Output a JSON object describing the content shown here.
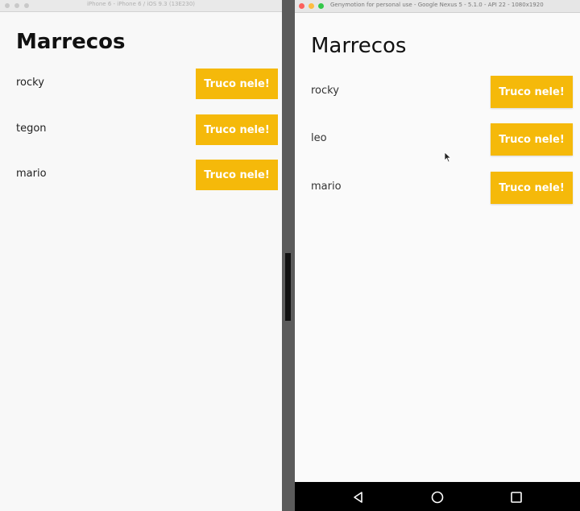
{
  "ios": {
    "window_title": "iPhone 6 - iPhone 6 / iOS 9.3 (13E230)",
    "heading": "Marrecos",
    "items": [
      {
        "name": "rocky",
        "button": "Truco nele!"
      },
      {
        "name": "tegon",
        "button": "Truco nele!"
      },
      {
        "name": "mario",
        "button": "Truco nele!"
      }
    ]
  },
  "android": {
    "window_title": "Genymotion for personal use - Google Nexus 5 - 5.1.0 - API 22 - 1080x1920",
    "heading": "Marrecos",
    "items": [
      {
        "name": "rocky",
        "button": "Truco nele!"
      },
      {
        "name": "leo",
        "button": "Truco nele!"
      },
      {
        "name": "mario",
        "button": "Truco nele!"
      }
    ],
    "nav": {
      "back": "back-icon",
      "home": "home-icon",
      "recents": "recents-icon"
    }
  },
  "colors": {
    "button": "#f5b90a",
    "button_text": "#ffffff",
    "traffic_close": "#fc605c",
    "traffic_min": "#fdbc40",
    "traffic_max": "#34c84a"
  }
}
